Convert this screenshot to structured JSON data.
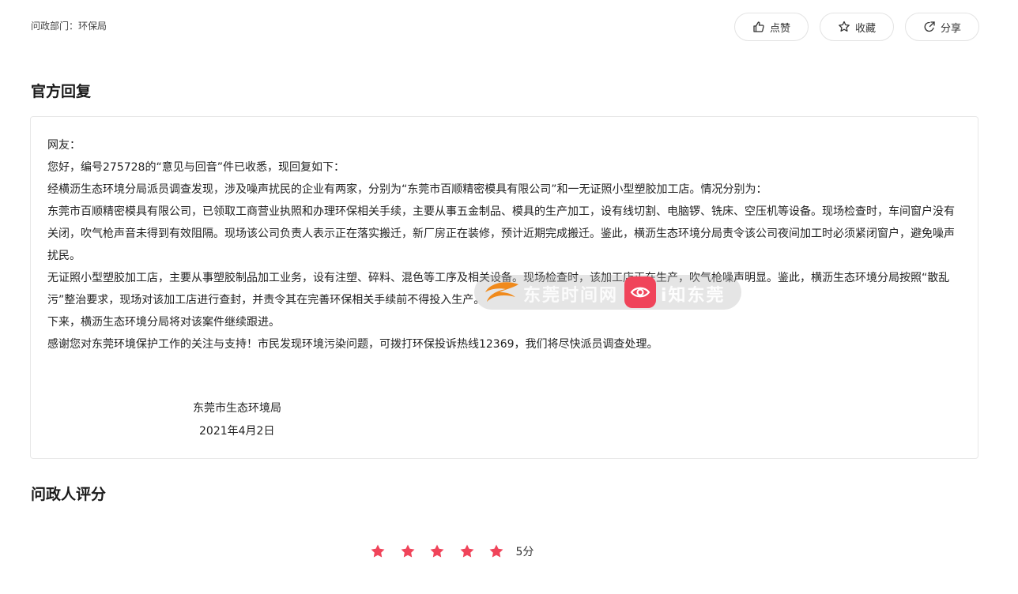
{
  "header": {
    "department_label": "问政部门：环保局"
  },
  "actions": {
    "like_label": "点赞",
    "favorite_label": "收藏",
    "share_label": "分享"
  },
  "official_reply": {
    "title": "官方回复",
    "paragraphs": [
      "网友：",
      "您好，编号275728的“意见与回音”件已收悉，现回复如下：",
      "经横沥生态环境分局派员调查发现，涉及噪声扰民的企业有两家，分别为“东莞市百顺精密模具有限公司”和一无证照小型塑胶加工店。情况分别为：",
      "东莞市百顺精密模具有限公司，已领取工商营业执照和办理环保相关手续，主要从事五金制品、模具的生产加工，设有线切割、电脑锣、铣床、空压机等设备。现场检查时，车间窗户没有关闭，吹气枪声音未得到有效阻隔。现场该公司负责人表示正在落实搬迁，新厂房正在装修，预计近期完成搬迁。鉴此，横沥生态环境分局责令该公司夜间加工时必须紧闭窗户，避免噪声扰民。",
      "无证照小型塑胶加工店，主要从事塑胶制品加工业务，设有注塑、碎料、混色等工序及相关设备。现场检查时，该加工店正在生产，吹气枪噪声明显。鉴此，横沥生态环境分局按照“散乱污”整治要求，现场对该加工店进行查封，并责令其在完善环保相关手续前不得投入生产。",
      "下来，横沥生态环境分局将对该案件继续跟进。",
      "感谢您对东莞环境保护工作的关注与支持！市民发现环境污染问题，可拨打环保投诉热线12369，我们将尽快派员调查处理。"
    ],
    "signature_org": "东莞市生态环境局",
    "signature_date": "2021年4月2日"
  },
  "watermark": {
    "text_left": "东莞时间网",
    "text_right": "i知东莞"
  },
  "rating": {
    "title": "问政人评分",
    "stars": 5,
    "max_stars": 5,
    "score_label": "5分",
    "star_color": "#f0445a"
  }
}
